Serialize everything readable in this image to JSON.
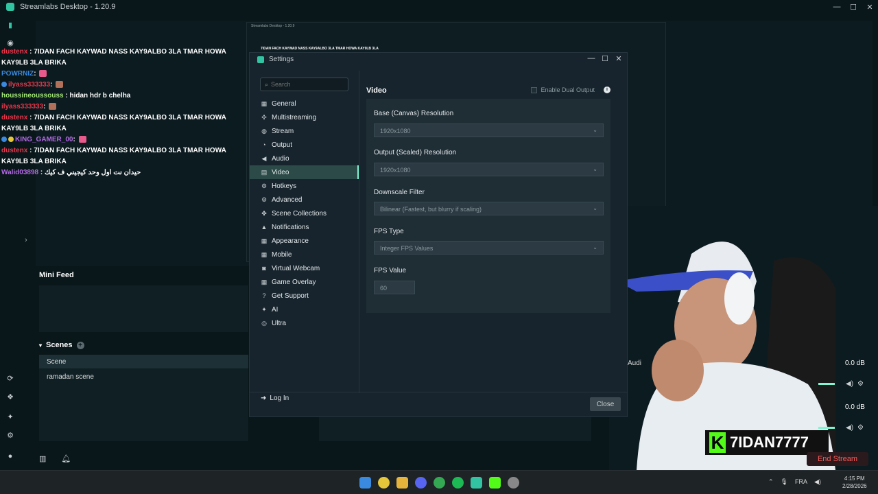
{
  "app": {
    "title": "Streamlabs Desktop - 1.20.9",
    "controls": [
      "—",
      "☐",
      "✕"
    ]
  },
  "chat": [
    {
      "user": "dustenx",
      "user_color": "#e6374b",
      "text": ": 7IDAN FACH KAYWAD NASS KAY9ALBO 3LA TMAR HOWA KAY9LB 3LA BRIKA"
    },
    {
      "user": "POWRNIZ",
      "user_color": "#3a8ae0",
      "text": ":"
    },
    {
      "user": "ilyass333333",
      "user_color": "#e6374b",
      "text": ":"
    },
    {
      "user": "houssineoussouss",
      "user_color": "#a5e87a",
      "text": ": hidan hdr b chelha"
    },
    {
      "user": "ilyass333333",
      "user_color": "#e6374b",
      "text": ":"
    },
    {
      "user": "dustenx",
      "user_color": "#e6374b",
      "text": ": 7IDAN FACH KAYWAD NASS KAY9ALBO 3LA TMAR HOWA KAY9LB 3LA BRIKA"
    },
    {
      "user": "KING_GAMER_00",
      "user_color": "#b56ae6",
      "text": ":"
    },
    {
      "user": "dustenx",
      "user_color": "#e6374b",
      "text": ": 7IDAN FACH KAYWAD NASS KAY9ALBO 3LA TMAR HOWA KAY9LB 3LA BRIKA"
    },
    {
      "user": "Walid03898",
      "user_color": "#b56ae6",
      "text": ": حيدان نت اول وحد كيجيني ف كيك"
    }
  ],
  "preview": {
    "title": "Streamlabs Desktop - 1.20.9",
    "chat_echo": "7IDAN FACH KAYWAD NASS KAY9ALBO 3LA TMAR HOWA KAY9LB 3LA"
  },
  "mini_feed": {
    "title": "Mini Feed"
  },
  "scenes": {
    "title": "Scenes",
    "column": "Scene",
    "items": [
      "ramadan scene"
    ]
  },
  "mixer": {
    "label": "Audi",
    "db1": "0.0 dB",
    "db2": "0.0 dB"
  },
  "stream": {
    "end_label": "End Stream"
  },
  "brand": {
    "name": "7IDAN7777"
  },
  "settings": {
    "title": "Settings",
    "search_placeholder": "Search",
    "nav": [
      {
        "label": "General",
        "icon": "grid-icon"
      },
      {
        "label": "Multistreaming",
        "icon": "multistream-icon"
      },
      {
        "label": "Stream",
        "icon": "globe-icon"
      },
      {
        "label": "Output",
        "icon": "output-icon"
      },
      {
        "label": "Audio",
        "icon": "speaker-icon"
      },
      {
        "label": "Video",
        "icon": "video-icon"
      },
      {
        "label": "Hotkeys",
        "icon": "keyboard-icon"
      },
      {
        "label": "Advanced",
        "icon": "gears-icon"
      },
      {
        "label": "Scene Collections",
        "icon": "collection-icon"
      },
      {
        "label": "Notifications",
        "icon": "bell-icon"
      },
      {
        "label": "Appearance",
        "icon": "palette-icon"
      },
      {
        "label": "Mobile",
        "icon": "mobile-icon"
      },
      {
        "label": "Virtual Webcam",
        "icon": "camera-icon"
      },
      {
        "label": "Game Overlay",
        "icon": "overlay-icon"
      },
      {
        "label": "Get Support",
        "icon": "help-icon"
      },
      {
        "label": "AI",
        "icon": "sparkle-icon"
      },
      {
        "label": "Ultra",
        "icon": "ultra-icon"
      }
    ],
    "active": "Video",
    "login_label": "Log In",
    "section_title": "Video",
    "dual_output_label": "Enable Dual Output",
    "fields": {
      "base_label": "Base (Canvas) Resolution",
      "base_value": "1920x1080",
      "output_label": "Output (Scaled) Resolution",
      "output_value": "1920x1080",
      "downscale_label": "Downscale Filter",
      "downscale_value": "Bilinear (Fastest, but blurry if scaling)",
      "fps_type_label": "FPS Type",
      "fps_type_value": "Integer FPS Values",
      "fps_value_label": "FPS Value",
      "fps_value": "60"
    },
    "close_label": "Close"
  },
  "taskbar": {
    "lang": "FRA",
    "time": "4:15 PM",
    "date": "2/28/2026"
  },
  "colors": {
    "accent": "#31c3a2",
    "active_nav": "#2c4a48",
    "end_stream": "#f55a5a",
    "kick_green": "#53fc18"
  }
}
